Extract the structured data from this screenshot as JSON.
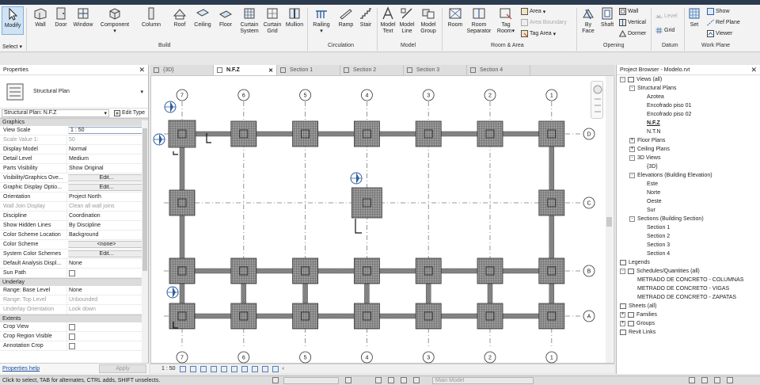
{
  "ribbon": {
    "modify": {
      "label": "Modify"
    },
    "select": {
      "label": "Select"
    },
    "build": {
      "label": "Build",
      "wall": "Wall",
      "door": "Door",
      "window": "Window",
      "component": "Component",
      "column": "Column",
      "roof": "Roof",
      "ceiling": "Ceiling",
      "floor": "Floor",
      "curtain_system_1": "Curtain",
      "curtain_system_2": "System",
      "curtain_grid_1": "Curtain",
      "curtain_grid_2": "Grid",
      "mullion": "Mullion"
    },
    "circulation": {
      "label": "Circulation",
      "railing": "Railing",
      "ramp": "Ramp",
      "stair": "Stair"
    },
    "model": {
      "label": "Model",
      "model_text_1": "Model",
      "model_text_2": "Text",
      "model_line_1": "Model",
      "model_line_2": "Line",
      "model_group_1": "Model",
      "model_group_2": "Group"
    },
    "room_area": {
      "label": "Room & Area",
      "room": "Room",
      "room_separator_1": "Room",
      "room_separator_2": "Separator",
      "tag_room_1": "Tag",
      "tag_room_2": "Room",
      "area": "Area",
      "area_boundary": "Area  Boundary",
      "tag_area": "Tag  Area"
    },
    "opening": {
      "label": "Opening",
      "by_face_1": "By",
      "by_face_2": "Face",
      "shaft": "Shaft",
      "wall": "Wall",
      "vertical": "Vertical",
      "dormer": "Dormer"
    },
    "datum": {
      "label": "Datum",
      "level": "Level",
      "grid": "Grid"
    },
    "work_plane": {
      "label": "Work Plane",
      "set": "Set",
      "show": "Show",
      "ref_plane": "Ref Plane",
      "viewer": "Viewer"
    }
  },
  "properties": {
    "title": "Properties",
    "family_type": "Structural Plan",
    "instance_selector": "Structural Plan: N.F.Z",
    "edit_type": "Edit Type",
    "sections": [
      {
        "title": "Graphics",
        "rows": [
          {
            "name": "View Scale",
            "value": "1 : 50",
            "kind": "input"
          },
          {
            "name": "Scale Value    1:",
            "value": "50",
            "kind": "disabled"
          },
          {
            "name": "Display Model",
            "value": "Normal",
            "kind": "text"
          },
          {
            "name": "Detail Level",
            "value": "Medium",
            "kind": "text"
          },
          {
            "name": "Parts Visibility",
            "value": "Show Original",
            "kind": "text"
          },
          {
            "name": "Visibility/Graphics Ove...",
            "value": "Edit...",
            "kind": "button"
          },
          {
            "name": "Graphic Display Optio...",
            "value": "Edit...",
            "kind": "button"
          },
          {
            "name": "Orientation",
            "value": "Project North",
            "kind": "text"
          },
          {
            "name": "Wall Join Display",
            "value": "Clean all wall joins",
            "kind": "disabled"
          },
          {
            "name": "Discipline",
            "value": "Coordination",
            "kind": "text"
          },
          {
            "name": "Show Hidden Lines",
            "value": "By Discipline",
            "kind": "text"
          },
          {
            "name": "Color Scheme Location",
            "value": "Background",
            "kind": "text"
          },
          {
            "name": "Color Scheme",
            "value": "<none>",
            "kind": "button"
          },
          {
            "name": "System Color Schemes",
            "value": "Edit...",
            "kind": "button"
          },
          {
            "name": "Default Analysis Displ...",
            "value": "None",
            "kind": "text"
          },
          {
            "name": "Sun Path",
            "value": "",
            "kind": "check"
          }
        ]
      },
      {
        "title": "Underlay",
        "rows": [
          {
            "name": "Range: Base Level",
            "value": "None",
            "kind": "text"
          },
          {
            "name": "Range: Top Level",
            "value": "Unbounded",
            "kind": "disabled"
          },
          {
            "name": "Underlay Orientation",
            "value": "Look down",
            "kind": "disabled"
          }
        ]
      },
      {
        "title": "Extents",
        "rows": [
          {
            "name": "Crop View",
            "value": "",
            "kind": "check"
          },
          {
            "name": "Crop Region Visible",
            "value": "",
            "kind": "check"
          },
          {
            "name": "Annotation Crop",
            "value": "",
            "kind": "check"
          }
        ]
      }
    ],
    "help_link": "Properties help",
    "apply": "Apply"
  },
  "view_tabs": [
    {
      "label": "{3D}",
      "active": false
    },
    {
      "label": "N.F.Z",
      "active": true
    },
    {
      "label": "Section 1",
      "active": false
    },
    {
      "label": "Section 2",
      "active": false
    },
    {
      "label": "Section 3",
      "active": false
    },
    {
      "label": "Section 4",
      "active": false
    }
  ],
  "plan": {
    "column_grids": [
      "7",
      "6",
      "5",
      "4",
      "3",
      "2",
      "1"
    ],
    "row_grids": [
      "D",
      "C",
      "B",
      "A"
    ],
    "scale": "1 : 50"
  },
  "browser": {
    "title": "Project Browser - Modelo.rvt",
    "items": [
      {
        "label": "Views (all)",
        "depth": 0,
        "toggle": "-",
        "icon": true
      },
      {
        "label": "Structural Plans",
        "depth": 1,
        "toggle": "-"
      },
      {
        "label": "Azotea",
        "depth": 2
      },
      {
        "label": "Encofrado piso 01",
        "depth": 2
      },
      {
        "label": "Encofrado piso 02",
        "depth": 2
      },
      {
        "label": "N.F.Z",
        "depth": 2,
        "bold": true
      },
      {
        "label": "N.T.N",
        "depth": 2
      },
      {
        "label": "Floor Plans",
        "depth": 1,
        "toggle": "+"
      },
      {
        "label": "Ceiling Plans",
        "depth": 1,
        "toggle": "+"
      },
      {
        "label": "3D Views",
        "depth": 1,
        "toggle": "-"
      },
      {
        "label": "{3D}",
        "depth": 2
      },
      {
        "label": "Elevations (Building Elevation)",
        "depth": 1,
        "toggle": "-"
      },
      {
        "label": "Este",
        "depth": 2
      },
      {
        "label": "Norte",
        "depth": 2
      },
      {
        "label": "Oeste",
        "depth": 2
      },
      {
        "label": "Sur",
        "depth": 2
      },
      {
        "label": "Sections (Building Section)",
        "depth": 1,
        "toggle": "-"
      },
      {
        "label": "Section 1",
        "depth": 2
      },
      {
        "label": "Section 2",
        "depth": 2
      },
      {
        "label": "Section 3",
        "depth": 2
      },
      {
        "label": "Section 4",
        "depth": 2
      },
      {
        "label": "Legends",
        "depth": 0,
        "icon": true
      },
      {
        "label": "Schedules/Quantities (all)",
        "depth": 0,
        "toggle": "-",
        "icon": true
      },
      {
        "label": "METRADO DE CONCRETO - COLUMNAS",
        "depth": 1
      },
      {
        "label": "METRADO DE CONCRETO - VIGAS",
        "depth": 1
      },
      {
        "label": "METRADO DE CONCRETO - ZAPATAS",
        "depth": 1
      },
      {
        "label": "Sheets (all)",
        "depth": 0,
        "icon": true
      },
      {
        "label": "Families",
        "depth": 0,
        "toggle": "+",
        "icon": true
      },
      {
        "label": "Groups",
        "depth": 0,
        "toggle": "+",
        "icon": true
      },
      {
        "label": "Revit Links",
        "depth": 0,
        "icon": true
      }
    ]
  },
  "status": {
    "message": "Click to select, TAB for alternates, CTRL adds, SHIFT unselects.",
    "model_selector": "Main Model"
  },
  "colors": {
    "accent": "#2b5797",
    "ribbon_bg": "#f3f3f3",
    "grid_line": "#7a7a7a",
    "footing": "#5e5e5e"
  }
}
